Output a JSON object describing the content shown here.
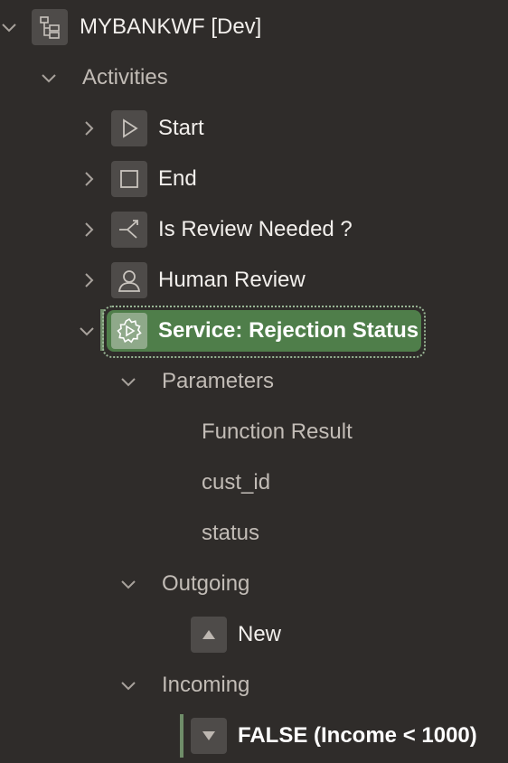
{
  "root": {
    "label": "MYBANKWF [Dev]"
  },
  "activities": {
    "label": "Activities",
    "items": [
      {
        "label": "Start"
      },
      {
        "label": "End"
      },
      {
        "label": "Is Review Needed ?"
      },
      {
        "label": "Human Review"
      },
      {
        "label": "Service: Rejection Status"
      }
    ]
  },
  "parameters": {
    "label": "Parameters",
    "items": [
      {
        "label": "Function Result"
      },
      {
        "label": "cust_id"
      },
      {
        "label": "status"
      }
    ]
  },
  "outgoing": {
    "label": "Outgoing",
    "items": [
      {
        "label": "New"
      }
    ]
  },
  "incoming": {
    "label": "Incoming",
    "items": [
      {
        "label": "FALSE (Income < 1000)"
      }
    ]
  },
  "colors": {
    "background": "#2f2c2a",
    "selected": "#4f7e4a",
    "icon_box": "#4e4b49"
  }
}
